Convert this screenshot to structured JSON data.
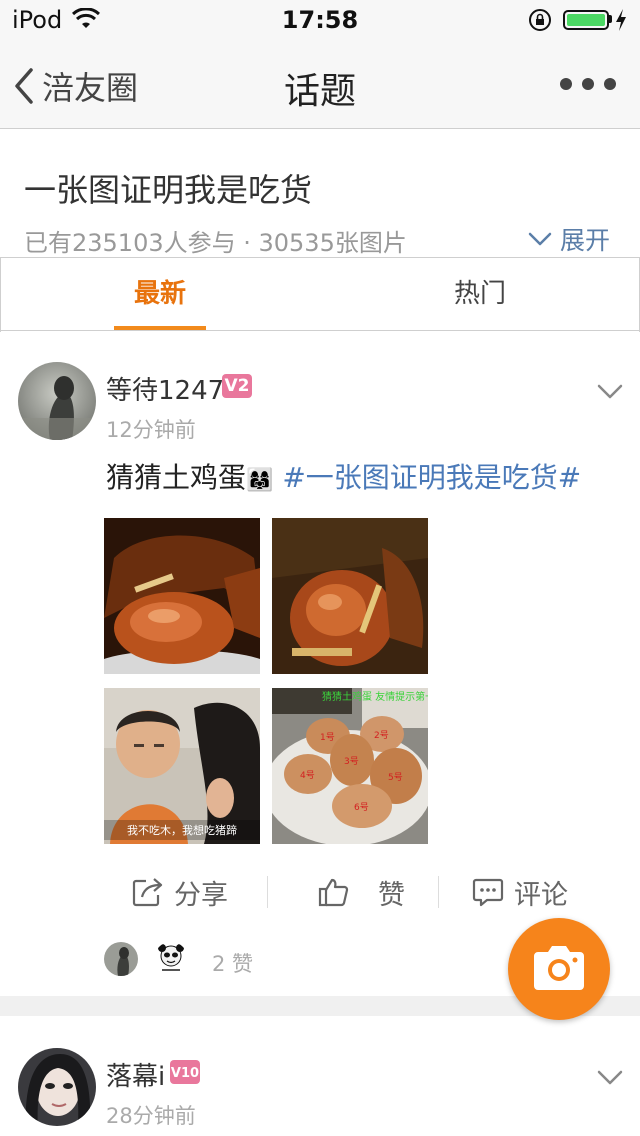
{
  "status_bar": {
    "carrier": "iPod",
    "time": "17:58",
    "battery_level": 1.0
  },
  "nav": {
    "back_label": "涪友圈",
    "title": "话题"
  },
  "topic": {
    "title": "一张图证明我是吃货",
    "stats": "已有235103人参与 · 30535张图片",
    "expand_label": "展开"
  },
  "tabs": [
    {
      "label": "最新",
      "active": true
    },
    {
      "label": "热门",
      "active": false
    }
  ],
  "posts": [
    {
      "username": "等待1247",
      "badge": "V2",
      "time": "12分钟前",
      "text": "猜猜土鸡蛋",
      "emoji": "👩‍👩‍👧",
      "hashtag": "#一张图证明我是吃货#",
      "photos": [
        {
          "kind": "braised-pork-knuckle"
        },
        {
          "kind": "braised-pork-knuckle-2"
        },
        {
          "kind": "meme-boy-and-girl",
          "caption": "我不吃木，我想吃猪蹄"
        },
        {
          "kind": "eggs-on-plate",
          "caption": "猜猜土鸡蛋 友情提示第一个",
          "labels": [
            "1号",
            "2号",
            "3号",
            "4号",
            "5号",
            "6号"
          ]
        }
      ],
      "actions": {
        "share": "分享",
        "like": "赞",
        "comment": "评论"
      },
      "likes_text": "2 赞"
    },
    {
      "username": "落幕i",
      "badge": "V10",
      "time": "28分钟前"
    }
  ],
  "colors": {
    "accent": "#f28a1c",
    "link": "#4a79b8",
    "badge": "#e9779c",
    "fab": "#f6841b"
  }
}
